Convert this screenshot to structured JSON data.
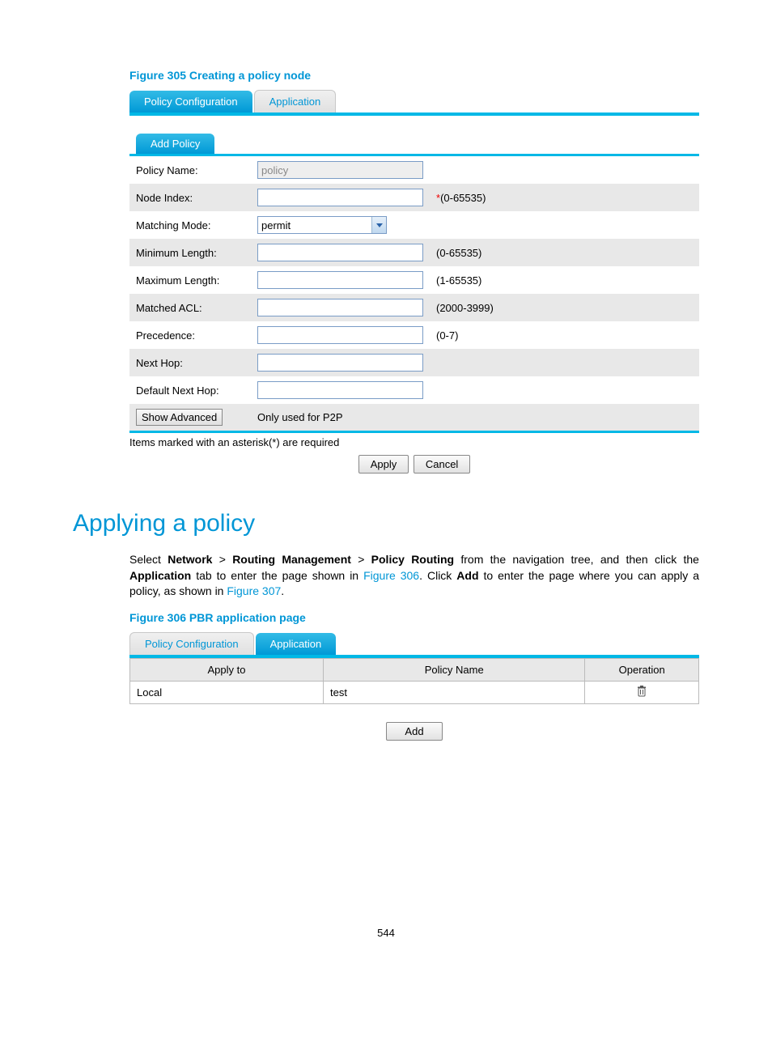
{
  "figure305": {
    "label": "Figure 305 Creating a policy node",
    "tabs": {
      "active": "Policy Configuration",
      "inactive": "Application"
    },
    "subtab": "Add Policy",
    "fields": {
      "policyName": {
        "label": "Policy Name:",
        "value": "policy"
      },
      "nodeIndex": {
        "label": "Node Index:",
        "value": "",
        "req": "*",
        "hint": "(0-65535)"
      },
      "matchingMode": {
        "label": "Matching Mode:",
        "value": "permit"
      },
      "minLength": {
        "label": "Minimum Length:",
        "value": "",
        "hint": "(0-65535)"
      },
      "maxLength": {
        "label": "Maximum Length:",
        "value": "",
        "hint": "(1-65535)"
      },
      "matchedAcl": {
        "label": "Matched ACL:",
        "value": "",
        "hint": "(2000-3999)"
      },
      "precedence": {
        "label": "Precedence:",
        "value": "",
        "hint": "(0-7)"
      },
      "nextHop": {
        "label": "Next Hop:",
        "value": ""
      },
      "defaultNextHop": {
        "label": "Default Next Hop:",
        "value": ""
      }
    },
    "showAdvanced": "Show Advanced",
    "p2pNote": "Only used for P2P",
    "requiredNote": "Items marked with an asterisk(*) are required",
    "apply": "Apply",
    "cancel": "Cancel"
  },
  "section": {
    "heading": "Applying a policy",
    "textParts": {
      "t1": "Select ",
      "t2": "Network",
      "t3": " > ",
      "t4": "Routing Management",
      "t5": " > ",
      "t6": "Policy Routing",
      "t7": " from the navigation tree, and then click the ",
      "t8": "Application",
      "t9": " tab to enter the page shown in ",
      "link1": "Figure 306",
      "t10": ". Click ",
      "t11": "Add",
      "t12": " to enter the page where you can apply a policy, as shown in ",
      "link2": "Figure 307",
      "t13": "."
    }
  },
  "figure306": {
    "label": "Figure 306 PBR application page",
    "tabs": {
      "inactive": "Policy Configuration",
      "active": "Application"
    },
    "table": {
      "headers": {
        "applyTo": "Apply to",
        "policyName": "Policy Name",
        "operation": "Operation"
      },
      "rows": [
        {
          "applyTo": "Local",
          "policyName": "test"
        }
      ]
    },
    "addBtn": "Add"
  },
  "pageNumber": "544"
}
